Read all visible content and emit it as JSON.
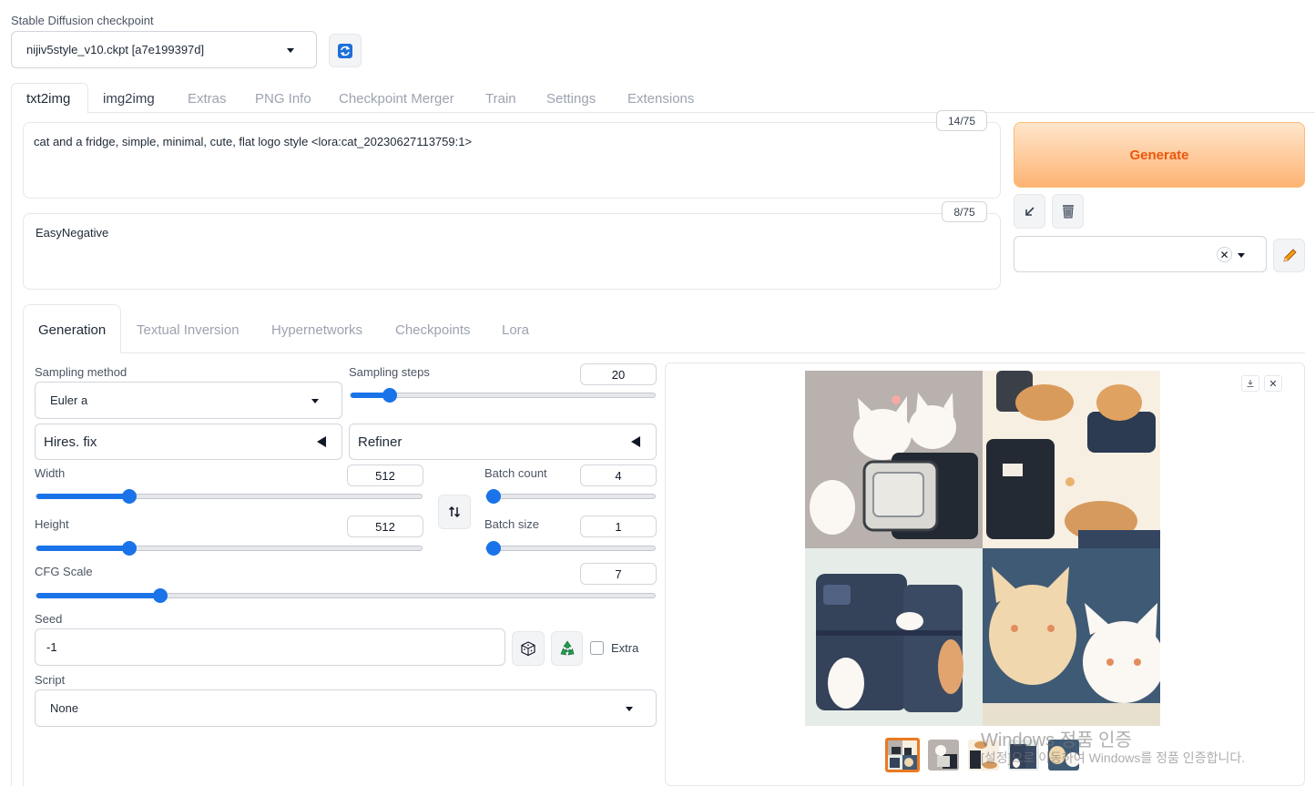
{
  "checkpoint": {
    "label": "Stable Diffusion checkpoint",
    "value": "nijiv5style_v10.ckpt [a7e199397d]",
    "refresh_icon": "refresh-icon"
  },
  "main_tabs": [
    "txt2img",
    "img2img",
    "Extras",
    "PNG Info",
    "Checkpoint Merger",
    "Train",
    "Settings",
    "Extensions"
  ],
  "prompt": {
    "text": "cat and a fridge, simple, minimal, cute, flat logo style <lora:cat_20230627113759:1>",
    "counter": "14/75"
  },
  "negative_prompt": {
    "text": "EasyNegative",
    "counter": "8/75"
  },
  "generate": {
    "label": "Generate",
    "color": "#ea580c"
  },
  "tool_icons": [
    "arrow-down-left-icon",
    "trash-icon",
    "clear-x-icon",
    "pencil-icon"
  ],
  "sub_tabs": [
    "Generation",
    "Textual Inversion",
    "Hypernetworks",
    "Checkpoints",
    "Lora"
  ],
  "params": {
    "sampling_method": {
      "label": "Sampling method",
      "value": "Euler a"
    },
    "sampling_steps": {
      "label": "Sampling steps",
      "value": "20",
      "fraction": 0.13
    },
    "hires_fix": "Hires. fix",
    "refiner": "Refiner",
    "width": {
      "label": "Width",
      "value": "512",
      "fraction": 0.24
    },
    "height": {
      "label": "Height",
      "value": "512",
      "fraction": 0.24
    },
    "batch_count": {
      "label": "Batch count",
      "value": "4",
      "fraction": 0.03
    },
    "batch_size": {
      "label": "Batch size",
      "value": "1",
      "fraction": 0.0
    },
    "cfg_scale": {
      "label": "CFG Scale",
      "value": "7",
      "fraction": 0.2
    },
    "seed": {
      "label": "Seed",
      "value": "-1"
    },
    "extra": "Extra",
    "script": {
      "label": "Script",
      "value": "None"
    }
  },
  "watermark": {
    "line1": "Windows 정품 인증",
    "line2": "[설정]으로 이동하여 Windows를 정품 인증합니다."
  },
  "accent_color": "#1a73e8"
}
